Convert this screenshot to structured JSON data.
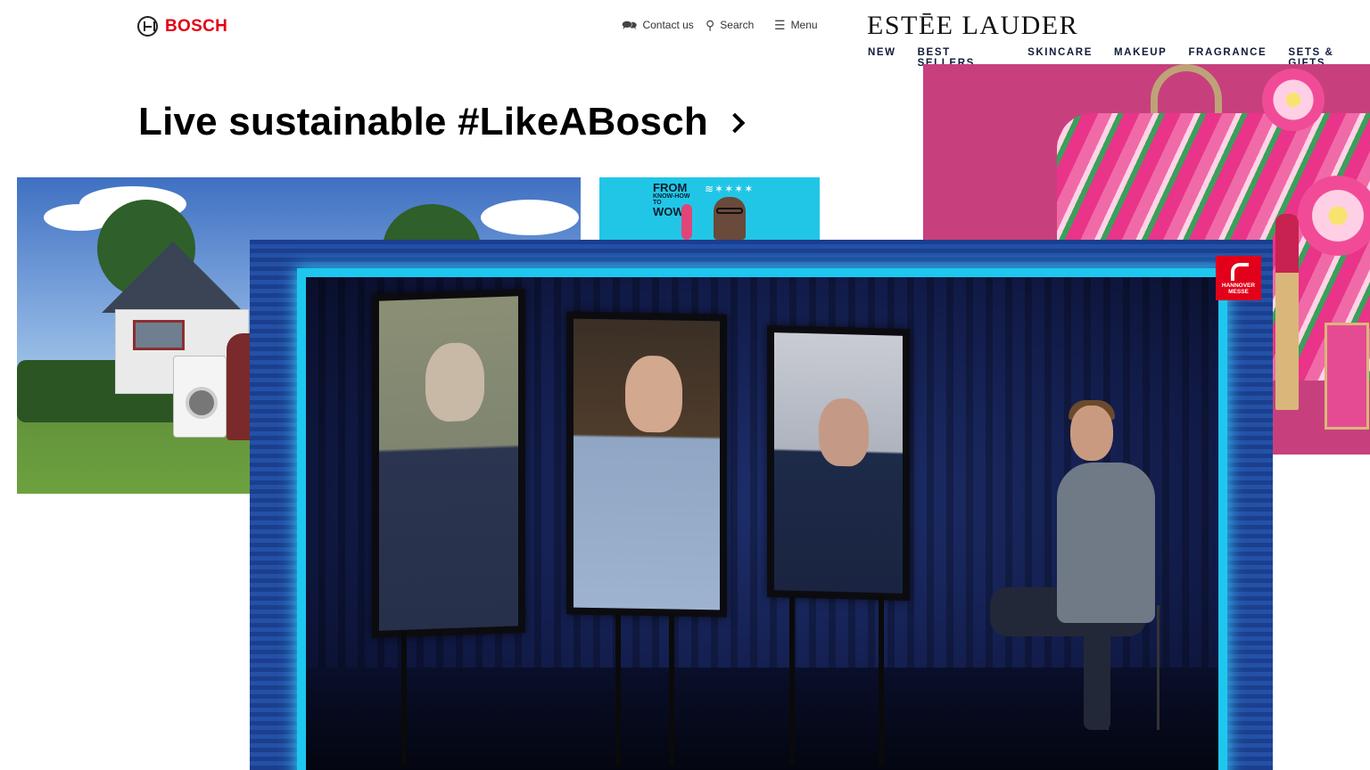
{
  "bosch": {
    "brand": "BOSCH",
    "nav": {
      "contact": "Contact us",
      "search": "Search",
      "menu": "Menu"
    },
    "headline": "Live sustainable #LikeABosch",
    "podcast": {
      "title_top": "FROM",
      "title_small": "KNOW-HOW TO",
      "title_bottom": "WOW",
      "wave": "≋✶✶✶✶"
    },
    "accent": "#e20015"
  },
  "esteelauder": {
    "brand": "ESTĒE LAUDER",
    "nav": [
      "NEW",
      "BEST SELLERS",
      "SKINCARE",
      "MAKEUP",
      "FRAGRANCE",
      "SETS & GIFTS"
    ],
    "hero_color": "#c7407d"
  },
  "video": {
    "badge_line1": "HANNOVER",
    "badge_line2": "MESSE",
    "frame_color": "#1ec7ef",
    "badge_color": "#e2001a"
  },
  "icons": {
    "contact": "chat-icon",
    "search": "search-icon",
    "menu": "menu-icon",
    "headline_arrow": "chevron-right-icon"
  }
}
